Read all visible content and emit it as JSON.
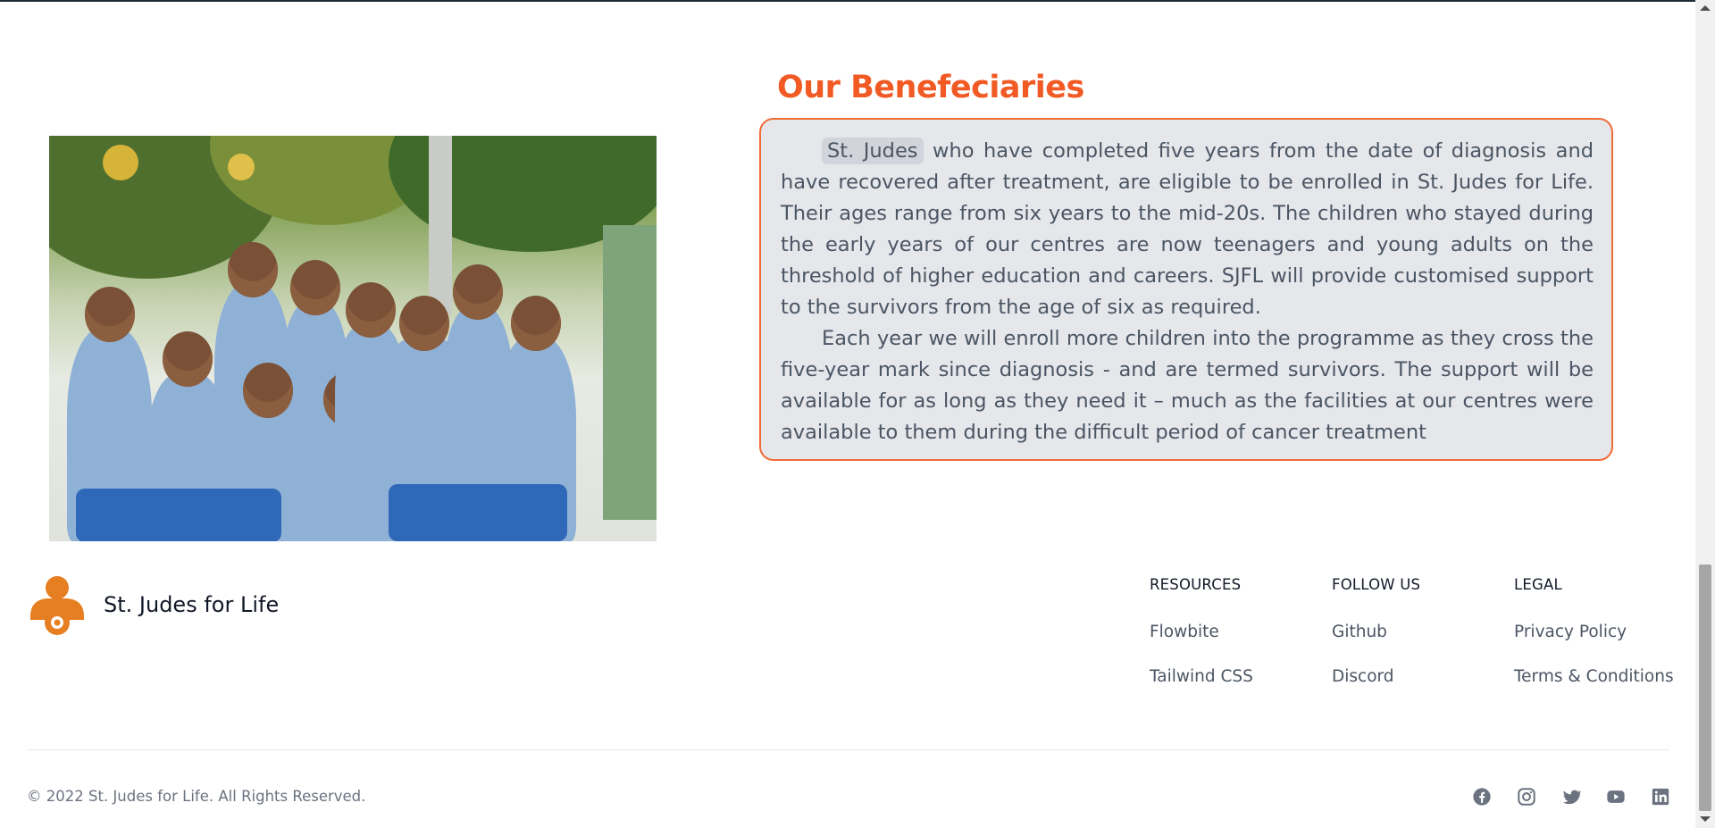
{
  "section": {
    "title": "Our Benefeciaries",
    "highlight": "St. Judes",
    "paragraph1_rest": " who have completed five years from the date of diagnosis and have recovered after treatment, are eligible to be enrolled in St. Judes for Life. Their ages range from six years to the mid-20s. The children who stayed during the early years of our centres are now teenagers and young adults on the threshold of higher education and careers. SJFL will provide customised support to the survivors from the age of six as required.",
    "paragraph2": "Each year we will enroll more children into the programme as they cross the five-year mark since diagnosis - and are termed survivors. The support will be available for as long as they need it – much as the facilities at our centres were available to them during the difficult period of cancer treatment",
    "photo_icon": "group-of-children-photo"
  },
  "footer": {
    "brand_name": "St. Judes for Life",
    "logo_icon": "st-judes-logo-icon",
    "columns": [
      {
        "heading": "Resources",
        "links": [
          "Flowbite",
          "Tailwind CSS"
        ]
      },
      {
        "heading": "Follow us",
        "links": [
          "Github",
          "Discord"
        ]
      },
      {
        "heading": "Legal",
        "links": [
          "Privacy Policy",
          "Terms & Conditions"
        ]
      }
    ],
    "copyright": "© 2022 St. Judes for Life. All Rights Reserved.",
    "social_icons": [
      "facebook-icon",
      "instagram-icon",
      "twitter-icon",
      "youtube-icon",
      "linkedin-icon"
    ]
  },
  "colors": {
    "accent": "#f15a24",
    "box_border": "#f26b38",
    "box_bg": "#e5e7eb",
    "logo": "#e67e22"
  }
}
